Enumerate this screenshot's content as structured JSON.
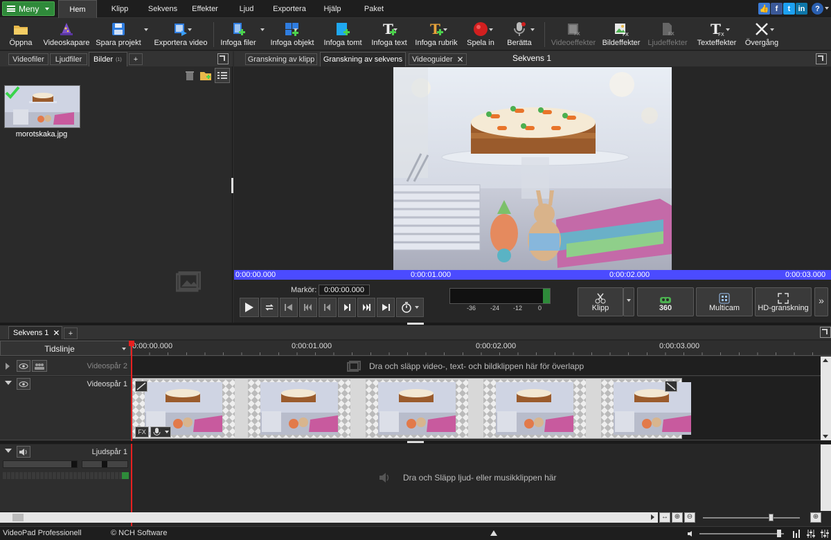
{
  "menubar": {
    "menu_label": "Meny",
    "tabs": [
      "Hem",
      "Klipp",
      "Sekvens",
      "Effekter",
      "Ljud",
      "Exportera",
      "Hjälp",
      "Paket"
    ],
    "active_tab": "Hem"
  },
  "toolbar": {
    "open": "Öppna",
    "videomaker": "Videoskapare",
    "save_project": "Spara projekt",
    "export_video": "Exportera video",
    "insert_files": "Infoga filer",
    "insert_object": "Infoga objekt",
    "insert_blank": "Infoga tomt",
    "insert_text": "Infoga text",
    "insert_title": "Infoga rubrik",
    "record": "Spela in",
    "narrate": "Berätta",
    "video_effects": "Videoeffekter",
    "image_effects": "Bildeffekter",
    "audio_effects": "Ljudeffekter",
    "text_effects": "Texteffekter",
    "transition": "Övergång"
  },
  "bin": {
    "tabs": [
      "Videofiler",
      "Ljudfiler",
      "Bilder"
    ],
    "images_count": "(1)",
    "file_name": "morotskaka.jpg"
  },
  "preview": {
    "tabs": [
      "Granskning av klipp",
      "Granskning av sekvens",
      "Videoguider"
    ],
    "title": "Sekvens 1",
    "ruler": [
      "0:00:00.000",
      "0:00:01.000",
      "0:00:02.000",
      "0:00:03.000"
    ],
    "marker_label": "Markör:",
    "marker_value": "0:00:00.000",
    "meter_ticks": [
      "-36",
      "-24",
      "-12",
      "0"
    ],
    "buttons": {
      "cut": "Klipp",
      "vr": "360",
      "multicam": "Multicam",
      "hd": "HD-granskning"
    }
  },
  "timeline": {
    "tab": "Sekvens 1",
    "mode": "Tidslinje",
    "ruler": [
      "0:00:00.000",
      "0:00:01.000",
      "0:00:02.000",
      "0:00:03.000"
    ],
    "video_track_2": "Videospår 2",
    "video_track_1": "Videospår 1",
    "audio_track_1": "Ljudspår 1",
    "overlay_hint": "Dra och släpp video-, text- och bildklippen här för överlapp",
    "audio_hint": "Dra och Släpp ljud- eller musikklippen här"
  },
  "statusbar": {
    "product": "VideoPad Professionell",
    "copyright": "© NCH Software"
  }
}
